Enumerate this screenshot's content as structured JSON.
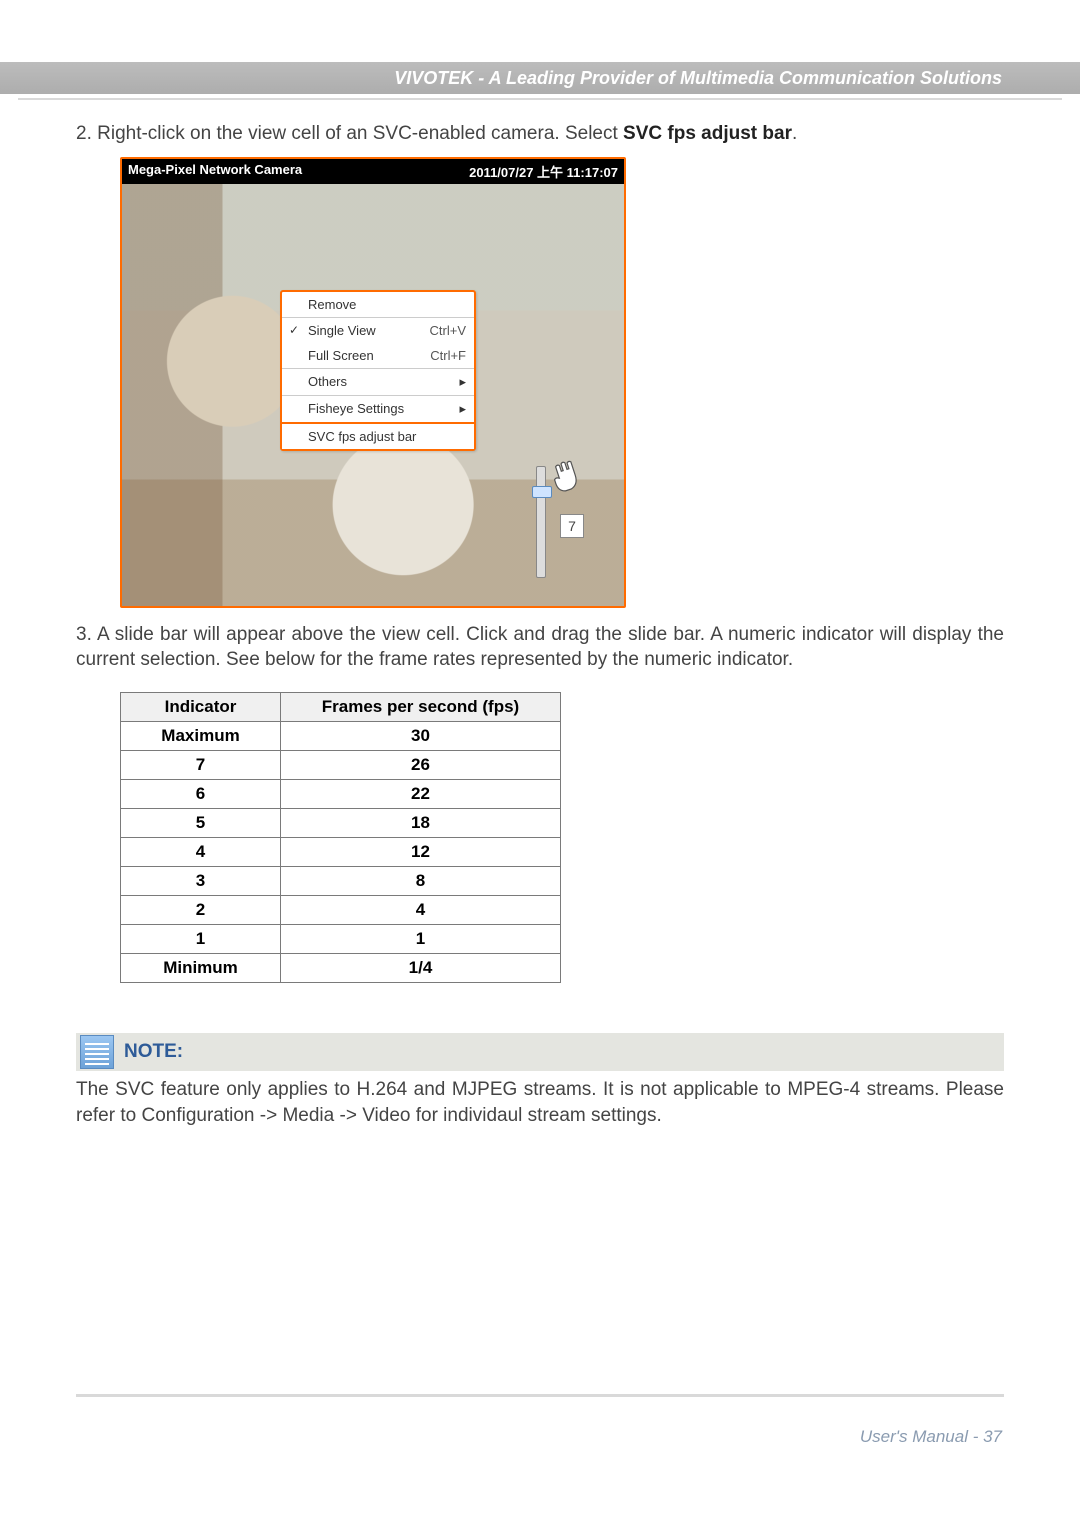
{
  "header": {
    "title": "VIVOTEK - A Leading Provider of Multimedia Communication Solutions"
  },
  "step2": {
    "prefix": "2. Right-click on the view cell of an SVC-enabled camera. Select ",
    "bold": "SVC fps adjust bar",
    "suffix": "."
  },
  "camera": {
    "title": "Mega-Pixel Network Camera",
    "timestamp": "2011/07/27 上午 11:17:07",
    "slider_indicator": "7"
  },
  "context_menu": {
    "remove": "Remove",
    "single_view": "Single View",
    "single_view_sc": "Ctrl+V",
    "full_screen": "Full Screen",
    "full_screen_sc": "Ctrl+F",
    "others": "Others",
    "fisheye": "Fisheye Settings",
    "svc": "SVC fps adjust bar"
  },
  "step3": {
    "text": "3. A slide bar will appear above the view cell. Click and drag the slide bar. A numeric indicator will display the current selection. See below for the frame rates represented by the numeric indicator."
  },
  "table": {
    "h1": "Indicator",
    "h2": "Frames per second (fps)",
    "rows": [
      {
        "ind": "Maximum",
        "fps": "30"
      },
      {
        "ind": "7",
        "fps": "26"
      },
      {
        "ind": "6",
        "fps": "22"
      },
      {
        "ind": "5",
        "fps": "18"
      },
      {
        "ind": "4",
        "fps": "12"
      },
      {
        "ind": "3",
        "fps": "8"
      },
      {
        "ind": "2",
        "fps": "4"
      },
      {
        "ind": "1",
        "fps": "1"
      },
      {
        "ind": "Minimum",
        "fps": "1/4"
      }
    ]
  },
  "note": {
    "title": "NOTE:",
    "text": "The SVC feature only applies to H.264 and MJPEG streams. It is not applicable to MPEG-4 streams. Please refer to Configuration -> Media -> Video for individaul stream settings."
  },
  "footer": {
    "text": "User's Manual - 37"
  }
}
